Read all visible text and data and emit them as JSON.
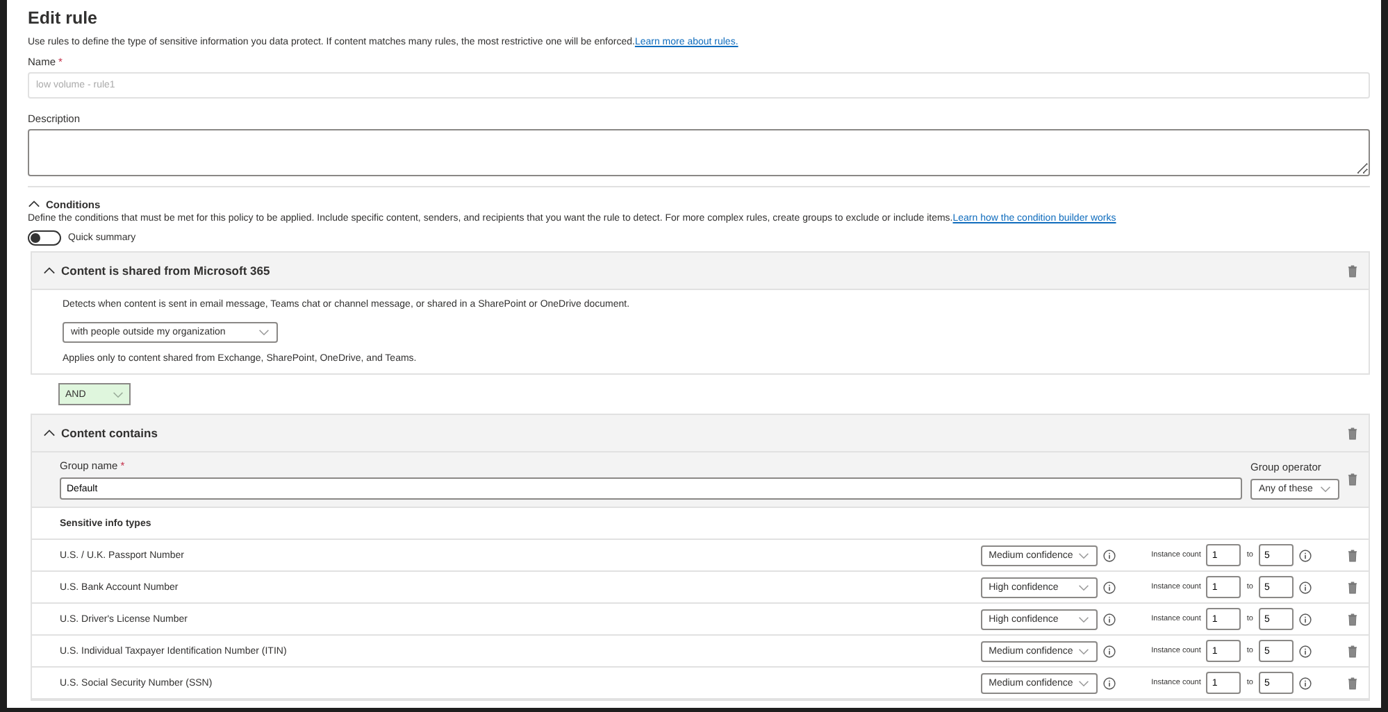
{
  "title": "Edit rule",
  "intro": {
    "text": "Use rules to define the type of sensitive information you data protect. If content matches many rules, the most restrictive one will be enforced.",
    "link": "Learn more about rules."
  },
  "name_field": {
    "label": "Name",
    "required_mark": "*",
    "placeholder": "low volume - rule1"
  },
  "description_field": {
    "label": "Description"
  },
  "conditions": {
    "title": "Conditions",
    "expanded": true,
    "text": "Define the conditions that must be met for this policy to be applied. Include specific content, senders, and recipients that you want the rule to detect. For more complex rules, create groups to exclude or include items.",
    "link": "Learn how the condition builder works",
    "quick_summary": {
      "label": "Quick summary",
      "on": false
    }
  },
  "shared_card": {
    "title": "Content is shared from Microsoft 365",
    "expanded": true,
    "description": "Detects when content is sent in email message, Teams chat or channel message, or shared in a SharePoint or OneDrive document.",
    "dropdown": "with people outside my organization",
    "note": "Applies only to content shared from Exchange, SharePoint, OneDrive, and Teams."
  },
  "operator": "AND",
  "contains_card": {
    "title": "Content contains",
    "expanded": true,
    "group_name_label": "Group name",
    "required_mark": "*",
    "group_name": "Default",
    "group_operator_label": "Group operator",
    "group_operator": "Any of these",
    "section_title": "Sensitive info types",
    "rows": [
      {
        "name": "U.S. / U.K. Passport Number",
        "confidence": "Medium confidence",
        "count_label": "Instance count",
        "min": "1",
        "to": "to",
        "max": "5"
      },
      {
        "name": "U.S. Bank Account Number",
        "confidence": "High confidence",
        "count_label": "Instance count",
        "min": "1",
        "to": "to",
        "max": "5"
      },
      {
        "name": "U.S. Driver's License Number",
        "confidence": "High confidence",
        "count_label": "Instance count",
        "min": "1",
        "to": "to",
        "max": "5"
      },
      {
        "name": "U.S. Individual Taxpayer Identification Number (ITIN)",
        "confidence": "Medium confidence",
        "count_label": "Instance count",
        "min": "1",
        "to": "to",
        "max": "5"
      },
      {
        "name": "U.S. Social Security Number (SSN)",
        "confidence": "Medium confidence",
        "count_label": "Instance count",
        "min": "1",
        "to": "to",
        "max": "5"
      }
    ]
  }
}
